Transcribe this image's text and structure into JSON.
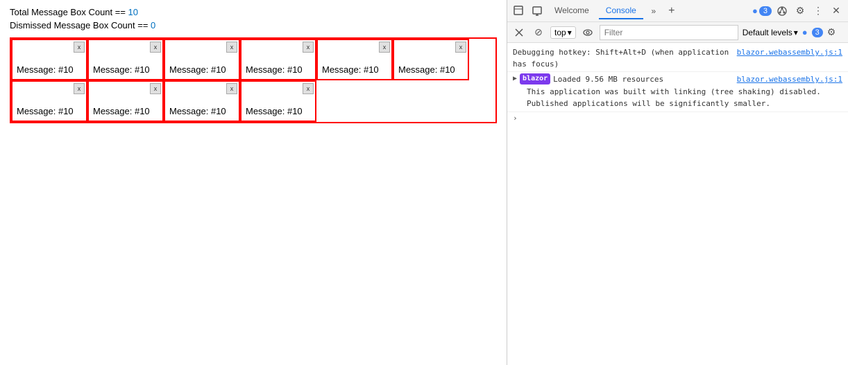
{
  "left": {
    "total_label": "Total Message Box Count == ",
    "total_value": "10",
    "dismissed_label": "Dismissed Message Box Count == ",
    "dismissed_value": "0",
    "messages": [
      {
        "text": "Message: #10",
        "row": 0
      },
      {
        "text": "Message: #10",
        "row": 0
      },
      {
        "text": "Message: #10",
        "row": 0
      },
      {
        "text": "Message: #10",
        "row": 0
      },
      {
        "text": "Message: #10",
        "row": 0
      },
      {
        "text": "Message: #10",
        "row": 0
      },
      {
        "text": "Message: #10",
        "row": 1
      },
      {
        "text": "Message: #10",
        "row": 1
      },
      {
        "text": "Message: #10",
        "row": 1
      },
      {
        "text": "Message: #10",
        "row": 1
      }
    ],
    "close_label": "x"
  },
  "devtools": {
    "tabs": [
      "Welcome",
      "Console"
    ],
    "active_tab": "Console",
    "icons": {
      "inspect": "⬚",
      "device": "⊟",
      "more": "»",
      "add": "+",
      "settings": "⚙",
      "more_vert": "⋮",
      "close": "✕"
    },
    "badge_count": "3",
    "toolbar2": {
      "stop_icon": "⊘",
      "context_label": "top",
      "context_arrow": "▾",
      "eye_icon": "👁",
      "filter_placeholder": "Filter",
      "level_label": "Default levels",
      "level_arrow": "▾",
      "message_count": "3"
    },
    "console_entries": [
      {
        "type": "plain",
        "text": "Debugging hotkey: Shift+Alt+D (when application has focus)",
        "source": "blazor.webassembly.js:1"
      },
      {
        "type": "blazor",
        "badge": "blazor",
        "text": "Loaded 9.56 MB resources",
        "source": "blazor.webassembly.js:1",
        "subtext": "This application was built with linking (tree shaking) disabled.\nPublished applications will be significantly smaller."
      }
    ]
  }
}
